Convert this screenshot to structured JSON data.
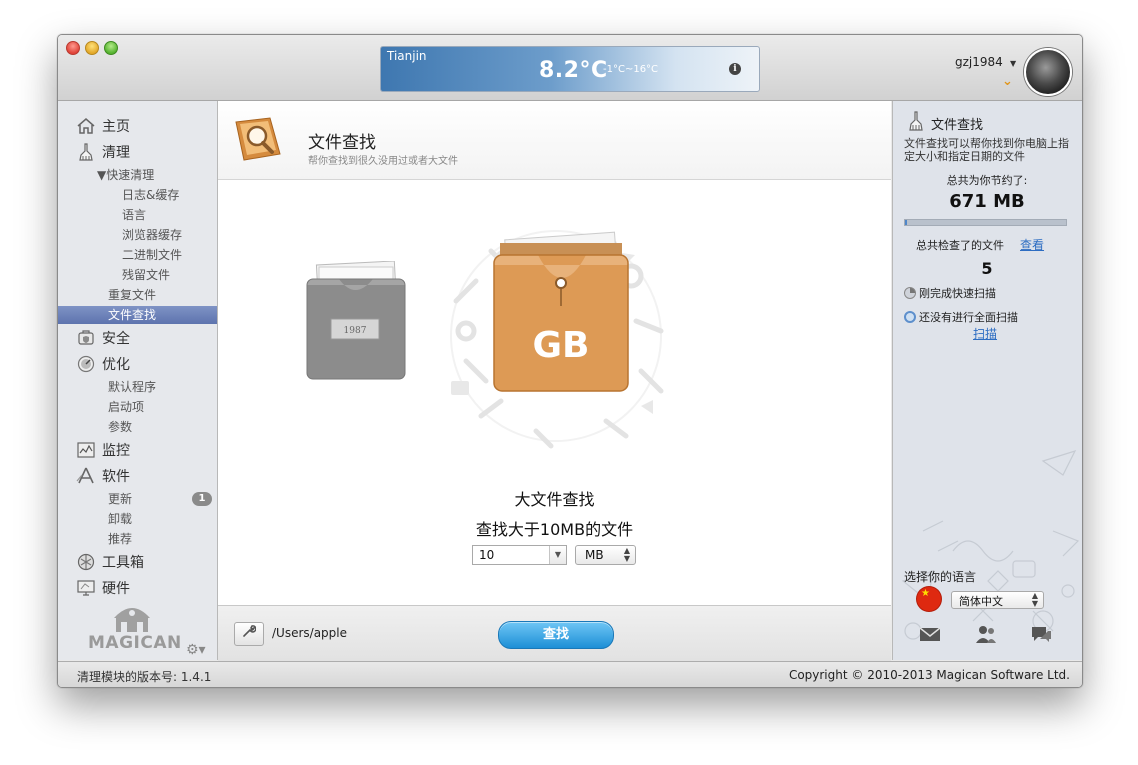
{
  "weather": {
    "city": "Tianjin",
    "temperature": "8.2°C",
    "range": "-1°C~16°C",
    "info_icon": "info-icon"
  },
  "user": {
    "username": "gzj1984"
  },
  "sidebar": {
    "items": [
      {
        "label": "主页",
        "icon": "home-icon"
      },
      {
        "label": "清理",
        "icon": "broom-icon"
      },
      {
        "label": "安全",
        "icon": "shield-icon"
      },
      {
        "label": "优化",
        "icon": "speedometer-icon"
      },
      {
        "label": "监控",
        "icon": "monitor-icon"
      },
      {
        "label": "软件",
        "icon": "appstore-icon"
      },
      {
        "label": "工具箱",
        "icon": "toolbox-icon"
      },
      {
        "label": "硬件",
        "icon": "hardware-icon"
      }
    ],
    "clean_sub": {
      "quick": "▼快速清理",
      "logs": "日志&缓存",
      "language": "语言",
      "browser": "浏览器缓存",
      "binary": "二进制文件",
      "leftover": "残留文件",
      "duplicate": "重复文件",
      "file_finder": "文件查找"
    },
    "optimize_sub": {
      "default_apps": "默认程序",
      "startup": "启动项",
      "params": "参数"
    },
    "software_sub": {
      "update": "更新",
      "update_count": "1",
      "uninstall": "卸载",
      "recommend": "推荐"
    },
    "logo": "MAGICAN"
  },
  "main": {
    "title": "文件查找",
    "subtitle": "帮你查找到很久没用过或者大文件",
    "folder_label": "GB",
    "finder_title": "大文件查找",
    "finder_desc": "查找大于10MB的文件",
    "size_value": "10",
    "unit_value": "MB",
    "path": "/Users/apple",
    "find_button": "查找"
  },
  "right_panel": {
    "title": "文件查找",
    "desc": "文件查找可以帮你找到你电脑上指定大小和指定日期的文件",
    "saved_label": "总共为你节约了:",
    "saved_value": "671 MB",
    "saved_progress": 0.01,
    "checked_label": "总共检查了的文件",
    "view_link": "查看",
    "checked_value": "5",
    "quick_scan_status": "刚完成快速扫描",
    "full_scan_status": "还没有进行全面扫描",
    "scan_link": "扫描",
    "lang_label": "选择你的语言",
    "lang_value": "简体中文"
  },
  "status": {
    "version": "清理模块的版本号: 1.4.1",
    "copyright": "Copyright © 2010-2013 Magican Software Ltd."
  },
  "colors": {
    "accent": "#1d8fd6",
    "sidebar_active": "#6e83bb",
    "folder_orange": "#dd9a55"
  }
}
